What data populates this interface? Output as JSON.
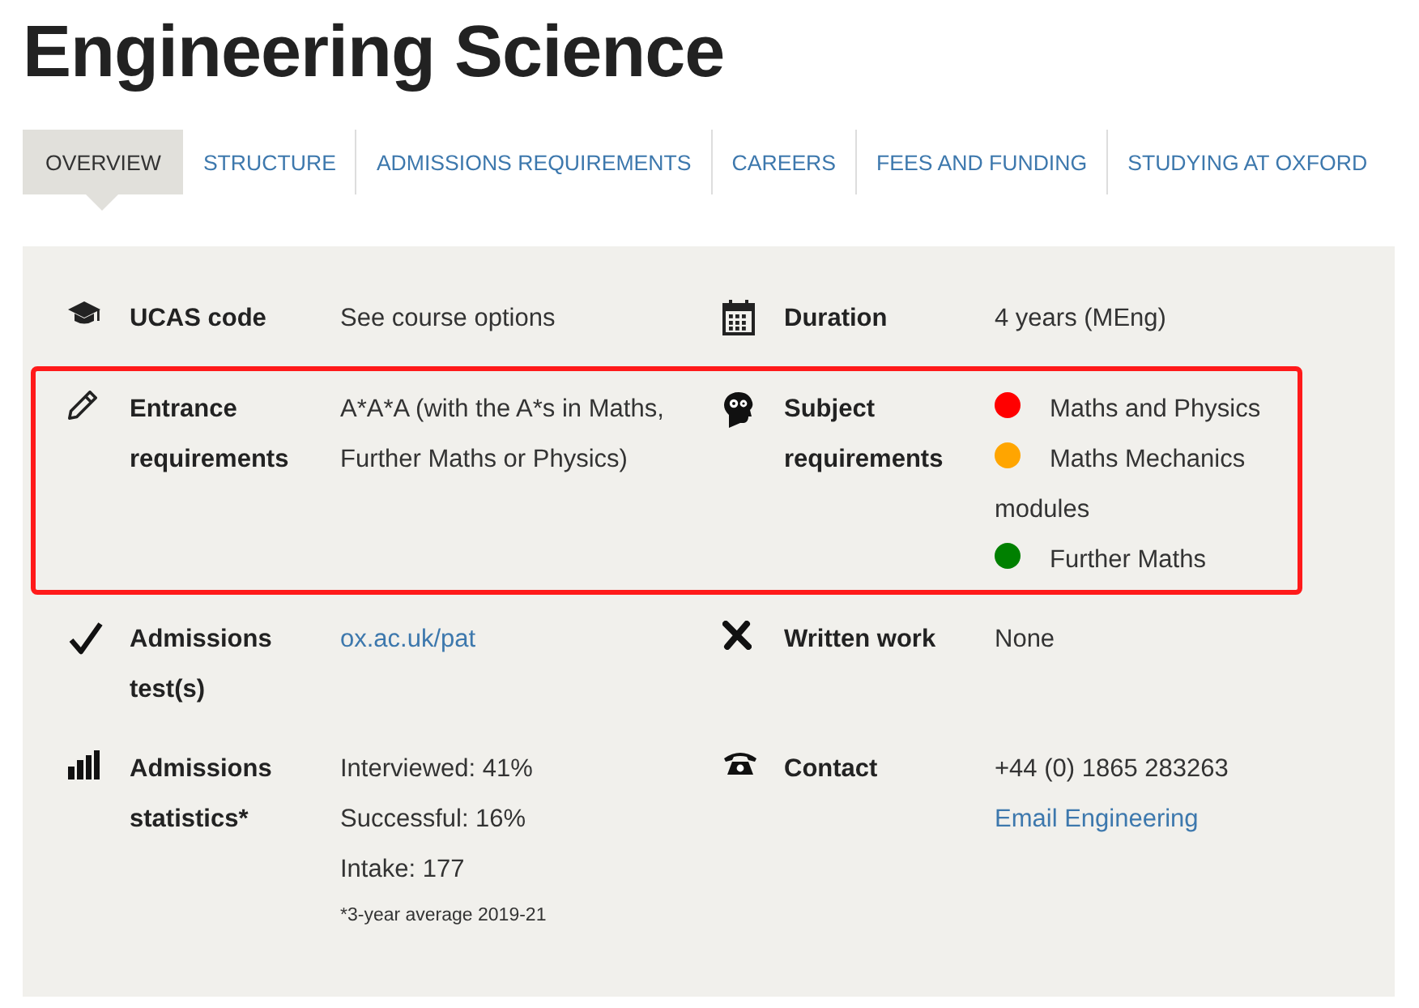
{
  "page_title": "Engineering Science",
  "tabs": [
    {
      "label": "OVERVIEW",
      "selected": true
    },
    {
      "label": "STRUCTURE",
      "selected": false
    },
    {
      "label": "ADMISSIONS REQUIREMENTS",
      "selected": false
    },
    {
      "label": "CAREERS",
      "selected": false
    },
    {
      "label": "FEES AND FUNDING",
      "selected": false
    },
    {
      "label": "STUDYING AT OXFORD",
      "selected": false
    }
  ],
  "rows": [
    {
      "highlighted": false,
      "cells": [
        {
          "label": "UCAS code",
          "lines": [
            {
              "kind": "text",
              "text": "See course options"
            }
          ]
        },
        {
          "label": "Duration",
          "lines": [
            {
              "kind": "text",
              "text": "4 years (MEng)"
            }
          ]
        }
      ]
    },
    {
      "highlighted": true,
      "cells": [
        {
          "label": "Entrance requirements",
          "lines": [
            {
              "kind": "text",
              "text": "A*A*A (with the A*s in Maths, Further Maths or Physics)"
            }
          ]
        },
        {
          "label": "Subject requirements",
          "lines": [
            {
              "kind": "dot",
              "color": "#ff0000",
              "text": "Maths and Physics"
            },
            {
              "kind": "dot",
              "color": "#ffa500",
              "text": "Maths Mechanics modules"
            },
            {
              "kind": "dot",
              "color": "#008000",
              "text": "Further Maths"
            }
          ]
        }
      ]
    },
    {
      "highlighted": false,
      "cells": [
        {
          "label": "Admissions test(s)",
          "lines": [
            {
              "kind": "link",
              "text": "ox.ac.uk/pat"
            }
          ]
        },
        {
          "label": "Written work",
          "lines": [
            {
              "kind": "text",
              "text": "None"
            }
          ]
        }
      ]
    },
    {
      "highlighted": false,
      "cells": [
        {
          "label": "Admissions statistics*",
          "lines": [
            {
              "kind": "text",
              "text": "Interviewed: 41%"
            },
            {
              "kind": "text",
              "text": "Successful: 16%"
            },
            {
              "kind": "text",
              "text": "Intake: 177"
            },
            {
              "kind": "note",
              "text": "*3-year average 2019-21"
            }
          ]
        },
        {
          "label": "Contact",
          "lines": [
            {
              "kind": "text",
              "text": "+44 (0) 1865 283263"
            },
            {
              "kind": "link",
              "text": "Email Engineering"
            }
          ]
        }
      ]
    }
  ]
}
